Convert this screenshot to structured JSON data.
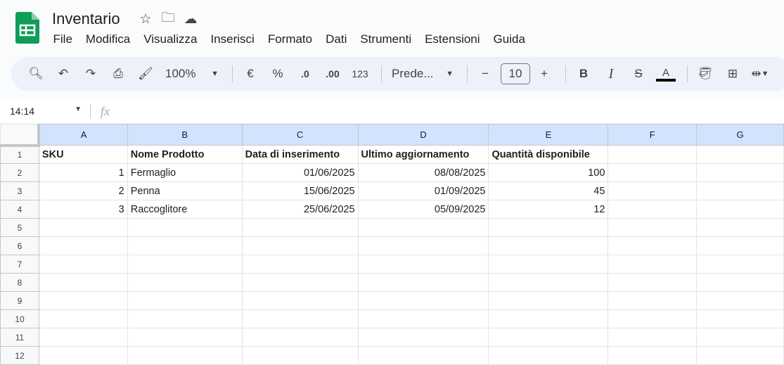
{
  "app": {
    "title": "Inventario"
  },
  "menu": [
    "File",
    "Modifica",
    "Visualizza",
    "Inserisci",
    "Formato",
    "Dati",
    "Strumenti",
    "Estensioni",
    "Guida"
  ],
  "toolbar": {
    "zoom": "100%",
    "currency": "€",
    "percent": "%",
    "dec_decrease": ".0",
    "dec_increase": ".00",
    "number_format": "123",
    "font": "Prede...",
    "font_size": "10",
    "bold": "B",
    "italic": "I",
    "text_color": "A"
  },
  "formula_bar": {
    "cell_ref": "14:14",
    "fx": "fx",
    "value": ""
  },
  "columns": [
    "A",
    "B",
    "C",
    "D",
    "E",
    "F",
    "G"
  ],
  "rows": [
    [
      "SKU",
      "Nome Prodotto",
      "Data di inserimento",
      "Ultimo aggiornamento",
      "Quantità disponibile",
      "",
      ""
    ],
    [
      "1",
      "Fermaglio",
      "01/06/2025",
      "08/08/2025",
      "100",
      "",
      ""
    ],
    [
      "2",
      "Penna",
      "15/06/2025",
      "01/09/2025",
      "45",
      "",
      ""
    ],
    [
      "3",
      "Raccoglitore",
      "25/06/2025",
      "05/09/2025",
      "12",
      "",
      ""
    ],
    [
      "",
      "",
      "",
      "",
      "",
      "",
      ""
    ],
    [
      "",
      "",
      "",
      "",
      "",
      "",
      ""
    ],
    [
      "",
      "",
      "",
      "",
      "",
      "",
      ""
    ],
    [
      "",
      "",
      "",
      "",
      "",
      "",
      ""
    ],
    [
      "",
      "",
      "",
      "",
      "",
      "",
      ""
    ],
    [
      "",
      "",
      "",
      "",
      "",
      "",
      ""
    ],
    [
      "",
      "",
      "",
      "",
      "",
      "",
      ""
    ],
    [
      "",
      "",
      "",
      "",
      "",
      "",
      ""
    ]
  ],
  "colors": {
    "accent": "#0f9d58",
    "header_selected": "#d3e3fd"
  }
}
